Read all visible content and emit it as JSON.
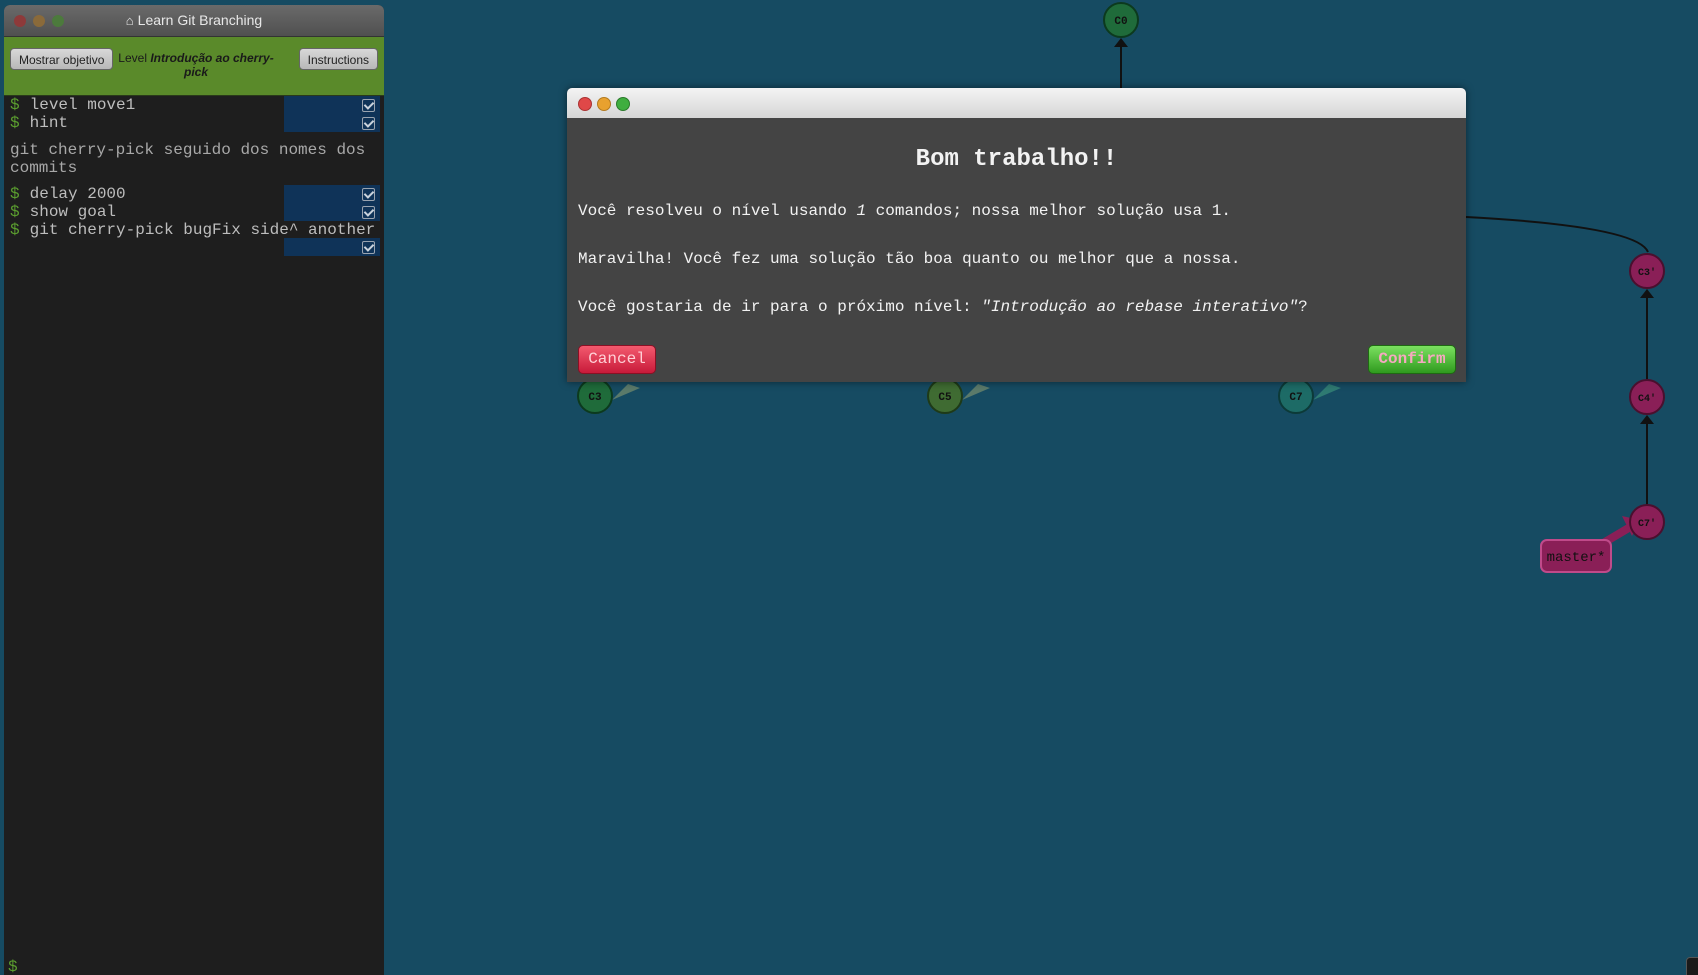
{
  "terminal": {
    "title": "Learn Git Branching",
    "home_icon": "home-icon",
    "goal_button": "Mostrar objetivo",
    "level_prefix": "Level",
    "level_name": "Introdução ao cherry-pick",
    "instructions_button": "Instructions",
    "prompt_symbol": "$",
    "commands": [
      {
        "text": "level move1",
        "status": "done"
      },
      {
        "text": "hint",
        "status": "done"
      },
      {
        "text": "delay 2000",
        "status": "done"
      },
      {
        "text": "show goal",
        "status": "done"
      },
      {
        "text": "git cherry-pick bugFix side^ another",
        "status": "done"
      }
    ],
    "hint_output": "git cherry-pick seguido dos nomes dos commits"
  },
  "graph": {
    "commits": [
      {
        "id": "C0",
        "color": "#1f6b3a"
      },
      {
        "id": "C3",
        "color": "#1f6b3a"
      },
      {
        "id": "C5",
        "color": "#3f6b32"
      },
      {
        "id": "C7",
        "color": "#1d6b66"
      },
      {
        "id": "C3'",
        "color": "#8a1f57"
      },
      {
        "id": "C4'",
        "color": "#8a1f57"
      },
      {
        "id": "C7'",
        "color": "#8a1f57"
      }
    ],
    "branch": {
      "name": "master*",
      "color": "#8a1f57"
    }
  },
  "dialog": {
    "title": "Bom trabalho!!",
    "line1_prefix": "Você resolveu o nível usando ",
    "line1_count": "1",
    "line1_suffix": " comandos; nossa melhor solução usa 1.",
    "line2": "Maravilha! Você fez uma solução tão boa quanto ou melhor que a nossa.",
    "line3_prefix": "Você gostaria de ir para o próximo nível: ",
    "line3_level": "\"Introdução ao rebase interativo\"",
    "line3_suffix": "?",
    "cancel_label": "Cancel",
    "confirm_label": "Confirm"
  }
}
